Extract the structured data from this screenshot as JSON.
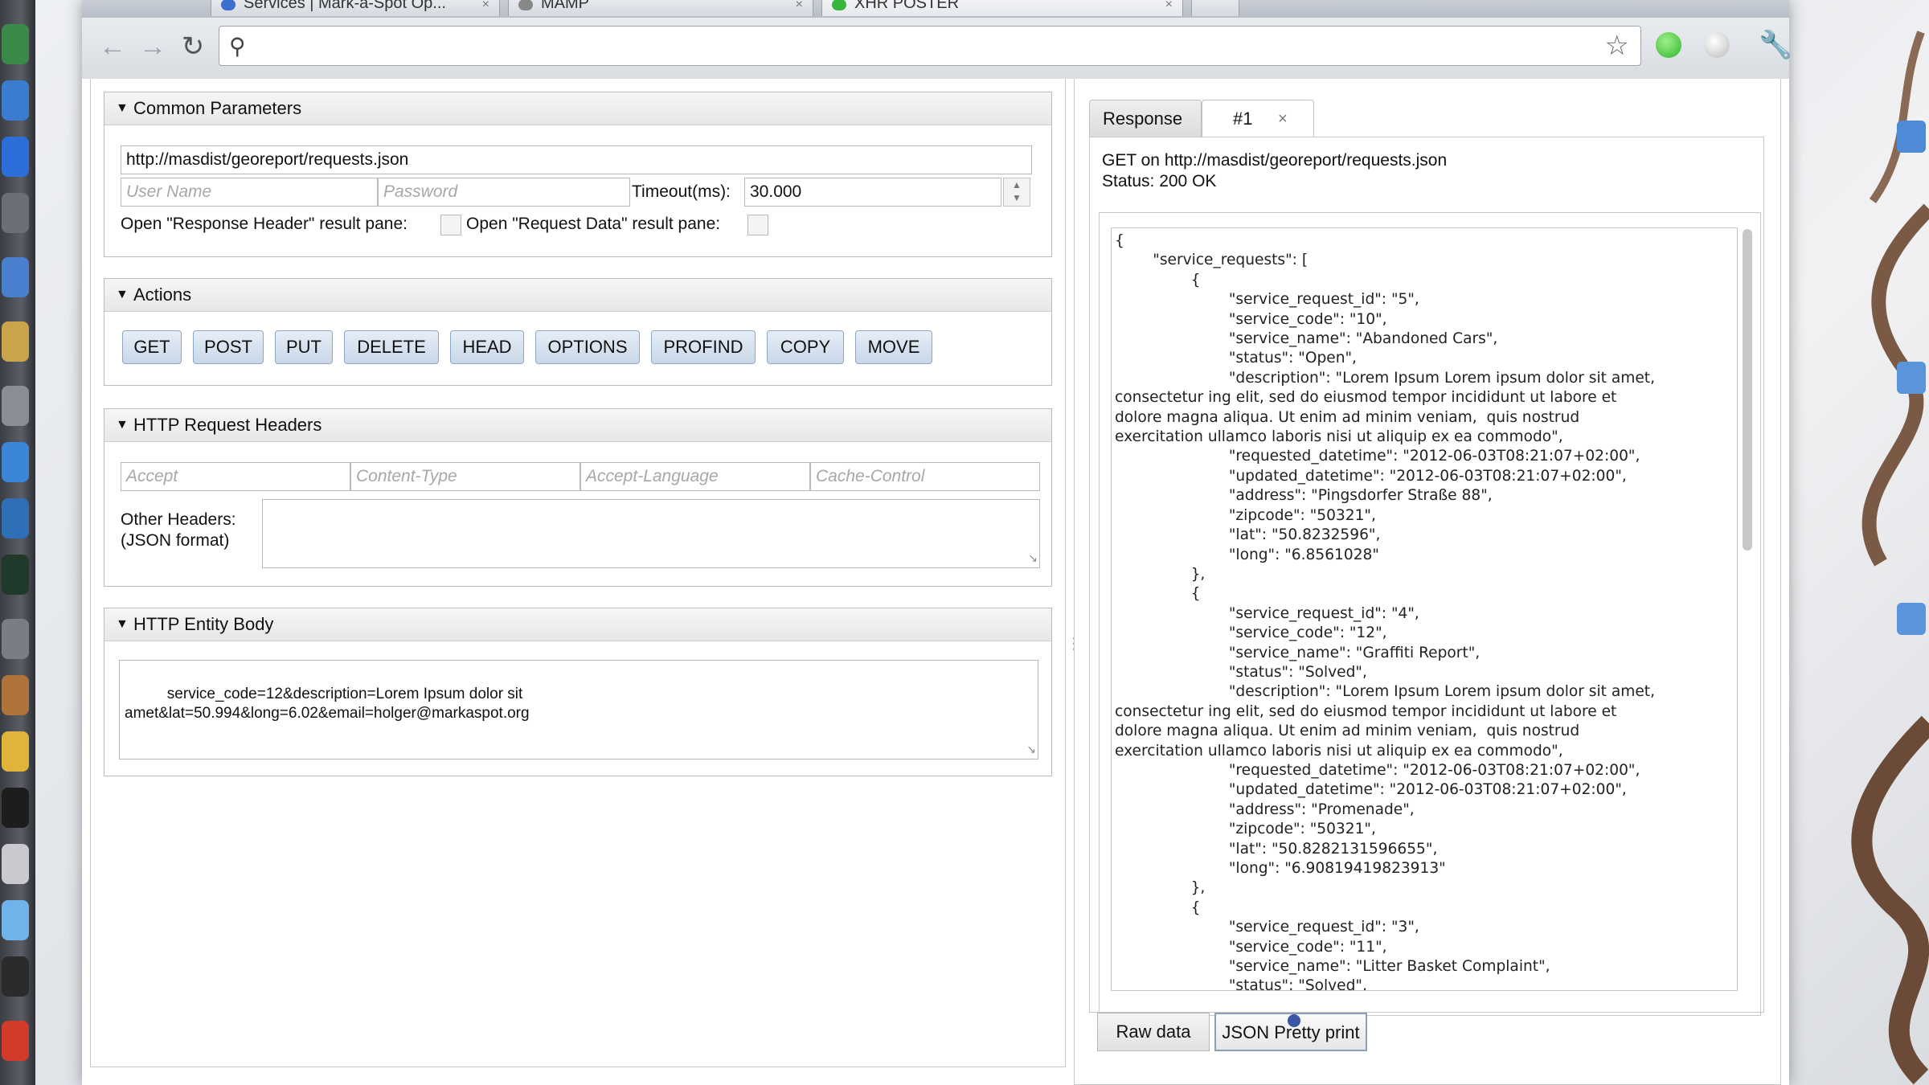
{
  "browser": {
    "tabs": [
      {
        "label": "Services | Mark-a-Spot Op..."
      },
      {
        "label": "MAMP"
      },
      {
        "label": "XHR POSTER"
      }
    ],
    "address": ""
  },
  "common": {
    "title": "Common Parameters",
    "url_value": "http://masdist/georeport/requests.json",
    "username_placeholder": "User Name",
    "password_placeholder": "Password",
    "timeout_label": "Timeout(ms):",
    "timeout_value": "30.000",
    "resp_header_label": "Open \"Response Header\" result pane:",
    "req_data_label": "Open \"Request Data\" result pane:"
  },
  "actions": {
    "title": "Actions",
    "buttons": [
      "GET",
      "POST",
      "PUT",
      "DELETE",
      "HEAD",
      "OPTIONS",
      "PROFIND",
      "COPY",
      "MOVE"
    ]
  },
  "headers": {
    "title": "HTTP Request Headers",
    "placeholders": [
      "Accept",
      "Content-Type",
      "Accept-Language",
      "Cache-Control"
    ],
    "other_label_1": "Other Headers:",
    "other_label_2": "(JSON format)"
  },
  "entity": {
    "title": "HTTP Entity Body",
    "body": "service_code=12&description=Lorem Ipsum dolor sit\namet&lat=50.994&long=6.02&email=holger@markaspot.org"
  },
  "response": {
    "tab_response": "Response",
    "tab_one": "#1",
    "tab_close": "×",
    "line1": "GET on http://masdist/georeport/requests.json",
    "line2": "Status: 200 OK",
    "json": "{\n        \"service_requests\": [\n                {\n                        \"service_request_id\": \"5\",\n                        \"service_code\": \"10\",\n                        \"service_name\": \"Abandoned Cars\",\n                        \"status\": \"Open\",\n                        \"description\": \"Lorem Ipsum Lorem ipsum dolor sit amet,\nconsectetur ing elit, sed do eiusmod tempor incididunt ut labore et\ndolore magna aliqua. Ut enim ad minim veniam,  quis nostrud\nexercitation ullamco laboris nisi ut aliquip ex ea commodo\",\n                        \"requested_datetime\": \"2012-06-03T08:21:07+02:00\",\n                        \"updated_datetime\": \"2012-06-03T08:21:07+02:00\",\n                        \"address\": \"Pingsdorfer Straße 88\",\n                        \"zipcode\": \"50321\",\n                        \"lat\": \"50.8232596\",\n                        \"long\": \"6.8561028\"\n                },\n                {\n                        \"service_request_id\": \"4\",\n                        \"service_code\": \"12\",\n                        \"service_name\": \"Graffiti Report\",\n                        \"status\": \"Solved\",\n                        \"description\": \"Lorem Ipsum Lorem ipsum dolor sit amet,\nconsectetur ing elit, sed do eiusmod tempor incididunt ut labore et\ndolore magna aliqua. Ut enim ad minim veniam,  quis nostrud\nexercitation ullamco laboris nisi ut aliquip ex ea commodo\",\n                        \"requested_datetime\": \"2012-06-03T08:21:07+02:00\",\n                        \"updated_datetime\": \"2012-06-03T08:21:07+02:00\",\n                        \"address\": \"Promenade\",\n                        \"zipcode\": \"50321\",\n                        \"lat\": \"50.8282131596655\",\n                        \"long\": \"6.90819419823913\"\n                },\n                {\n                        \"service_request_id\": \"3\",\n                        \"service_code\": \"11\",\n                        \"service_name\": \"Litter Basket Complaint\",\n                        \"status\": \"Solved\",",
    "raw_button": "Raw data",
    "pretty_button": "JSON Pretty print"
  },
  "icons": {
    "back": "arrow-left-icon",
    "forward": "arrow-right-icon",
    "reload": "reload-icon",
    "search": "search-icon",
    "star": "star-icon",
    "wrench": "wrench-icon"
  }
}
